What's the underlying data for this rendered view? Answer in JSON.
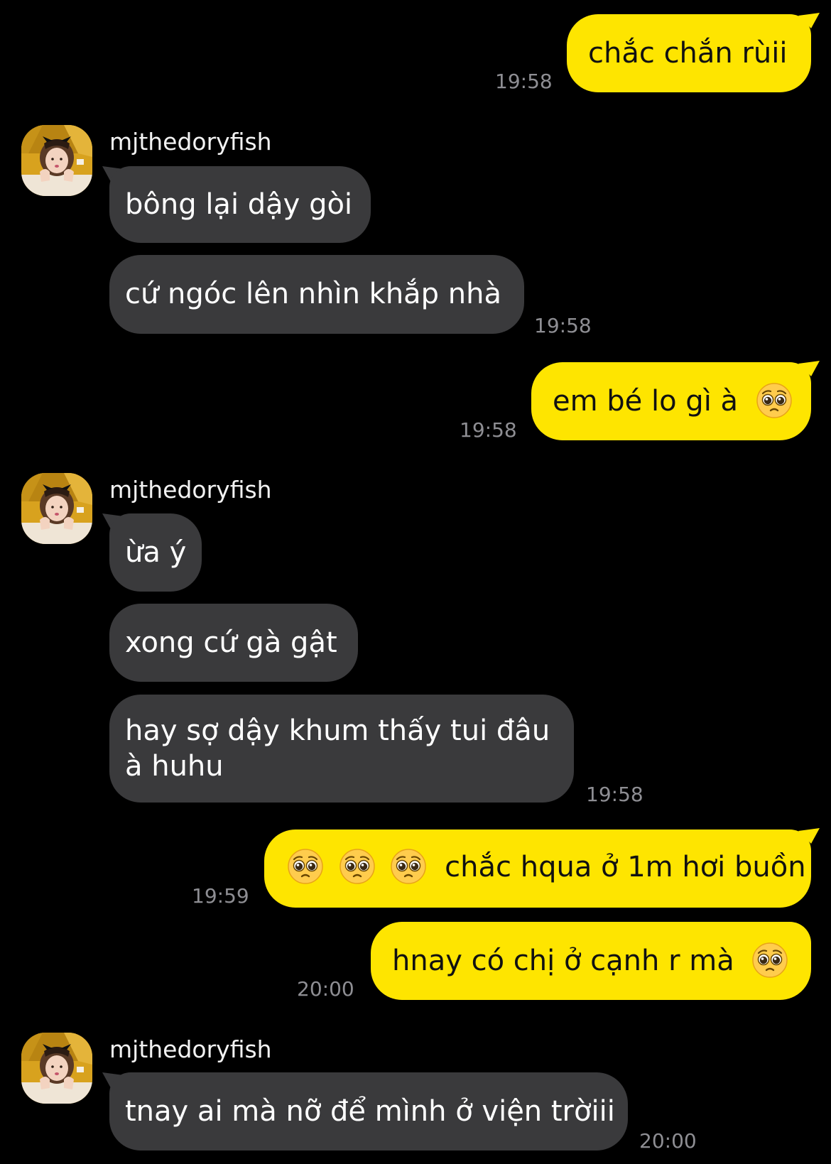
{
  "sender_name": "mjthedoryfish",
  "avatar_icon": "profile-photo-girl",
  "colors": {
    "background": "#000000",
    "outgoing_bubble": "#fee500",
    "incoming_bubble": "#3a3a3c",
    "timestamp": "#8e8e93"
  },
  "messages": [
    {
      "dir": "out",
      "text": "chắc chắn rùii",
      "time": "19:58"
    },
    {
      "dir": "in",
      "text": "bông lại dậy gòi"
    },
    {
      "dir": "in",
      "text": "cứ ngóc lên nhìn khắp nhà",
      "time": "19:58"
    },
    {
      "dir": "out",
      "text": "em bé lo gì à",
      "emoji_after": "pleading-face-emoji",
      "time": "19:58"
    },
    {
      "dir": "in",
      "text": "ừa ý"
    },
    {
      "dir": "in",
      "text": "xong cứ gà gật"
    },
    {
      "dir": "in",
      "text": "hay sợ dậy khum thấy tui đâu à huhu",
      "time": "19:58"
    },
    {
      "dir": "out",
      "text": "chắc hqua ở 1m hơi buồn",
      "emoji_before": [
        "pleading-face-emoji",
        "pleading-face-emoji",
        "pleading-face-emoji"
      ],
      "time": "19:59"
    },
    {
      "dir": "out",
      "text": "hnay có chị ở cạnh r mà",
      "emoji_after": "pleading-face-emoji",
      "time": "20:00"
    },
    {
      "dir": "in",
      "text": "tnay ai mà nỡ để mình ở viện trờiii",
      "time": "20:00"
    }
  ]
}
